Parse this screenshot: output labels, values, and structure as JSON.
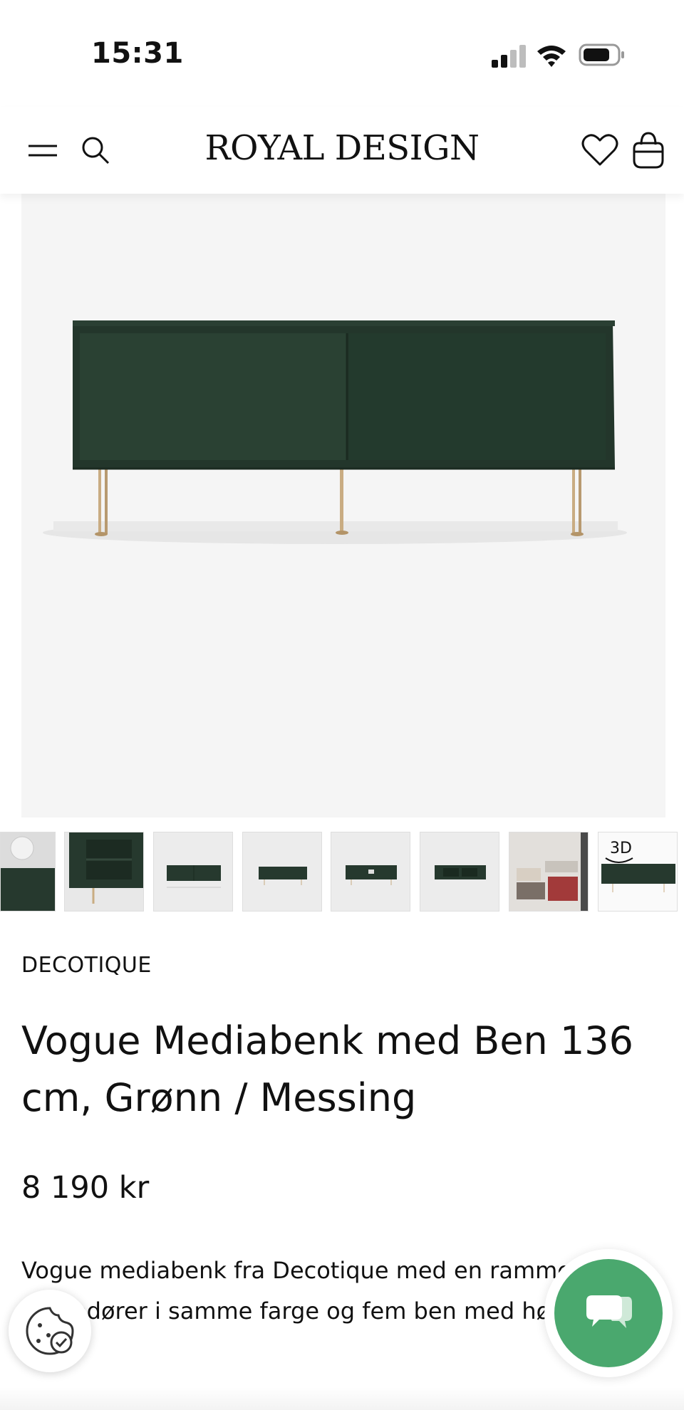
{
  "status_bar": {
    "time": "15:31"
  },
  "header": {
    "logo": "ROYAL DESIGN",
    "icons": {
      "menu": "hamburger-icon",
      "search": "search-icon",
      "wishlist": "heart-icon",
      "bag": "shopping-bag-icon"
    }
  },
  "colors": {
    "product_green": "#25382d",
    "chat_green": "#4aa86e",
    "brass": "#c9ac82"
  },
  "gallery": {
    "thumbnail_count": 8,
    "badge_3d": "3D"
  },
  "product": {
    "brand": "DECOTIQUE",
    "title": "Vogue Mediabenk med Ben 136 cm, Grønn / Messing",
    "price": "8 190 kr",
    "description": "Vogue mediabenk fra Decotique med en ramme med skyvedører i samme farge og fem ben med høyde."
  },
  "floating": {
    "cookie": "cookie-icon",
    "chat": "chat-icon"
  }
}
